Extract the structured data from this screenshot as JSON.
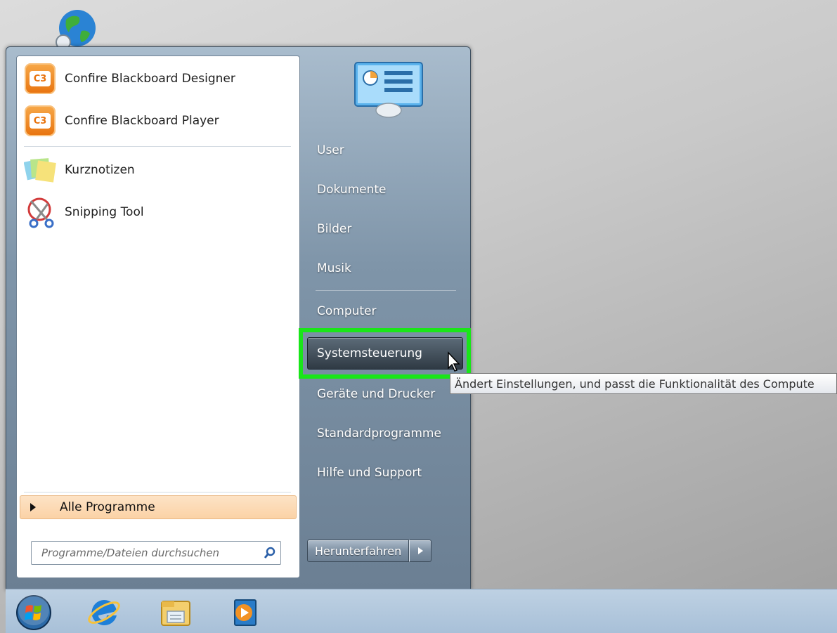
{
  "left_pane": {
    "programs_pinned": [
      {
        "label": "Confire Blackboard Designer",
        "icon": "confire-c3-icon"
      },
      {
        "label": "Confire Blackboard Player",
        "icon": "confire-c3-icon"
      }
    ],
    "programs_recent": [
      {
        "label": "Kurznotizen",
        "icon": "sticky-notes-icon"
      },
      {
        "label": "Snipping Tool",
        "icon": "scissors-icon"
      }
    ],
    "all_programs_label": "Alle Programme",
    "search": {
      "placeholder": "Programme/Dateien durchsuchen",
      "icon": "search-icon"
    }
  },
  "right_pane": {
    "user_picture_icon": "control-panel-user-icon",
    "items": [
      {
        "label": "User"
      },
      {
        "label": "Dokumente"
      },
      {
        "label": "Bilder"
      },
      {
        "label": "Musik"
      },
      {
        "label": "Computer"
      },
      {
        "label": "Systemsteuerung",
        "highlighted": true
      },
      {
        "label": "Geräte und Drucker"
      },
      {
        "label": "Standardprogramme"
      },
      {
        "label": "Hilfe und Support"
      }
    ],
    "shutdown_label": "Herunterfahren",
    "highlight_color": "#19e619"
  },
  "tooltip": {
    "text": "Ändert Einstellungen, und passt die Funktionalität des Compute"
  },
  "taskbar": {
    "items": [
      {
        "icon": "windows-start-orb-icon"
      },
      {
        "icon": "internet-explorer-icon"
      },
      {
        "icon": "windows-explorer-icon"
      },
      {
        "icon": "media-player-icon"
      }
    ]
  }
}
